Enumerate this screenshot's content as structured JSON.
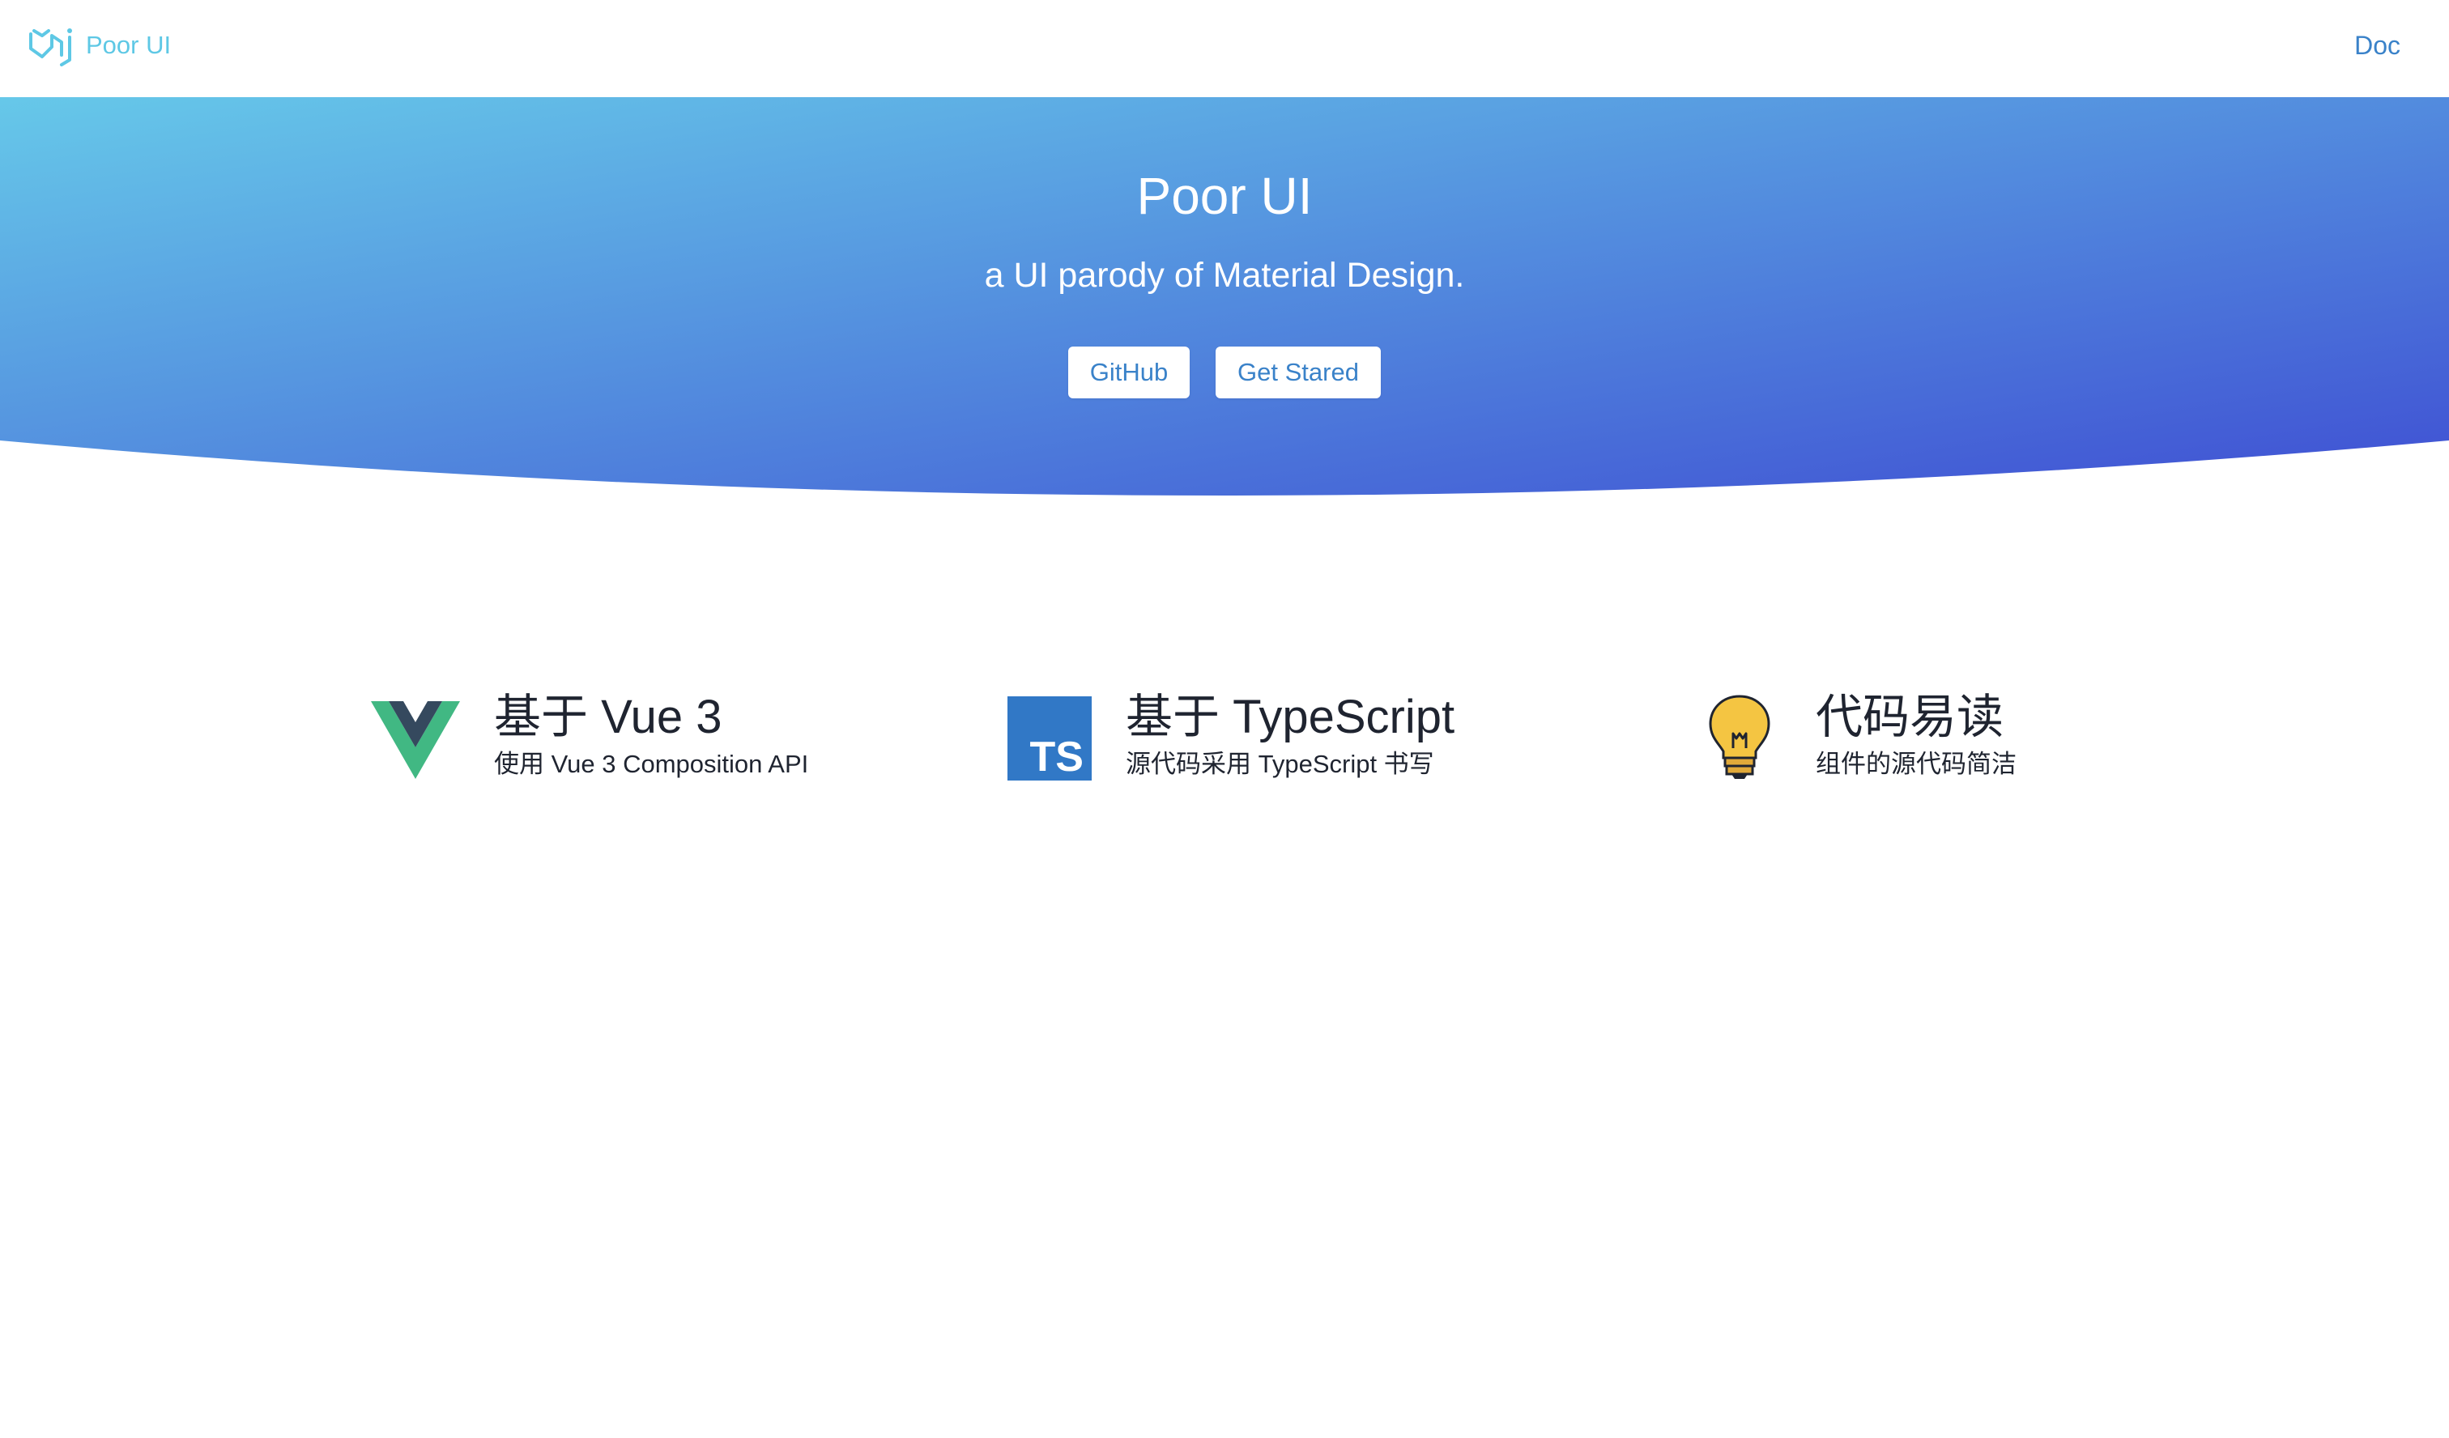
{
  "nav": {
    "logo_text": "Poor UI",
    "doc_label": "Doc"
  },
  "hero": {
    "title": "Poor UI",
    "subtitle": "a UI parody of Material Design.",
    "github_label": "GitHub",
    "start_label": "Get Stared",
    "gradient_start": "#66c8e9",
    "gradient_end": "#3f4fd3"
  },
  "features": [
    {
      "icon": "vue-logo-icon",
      "title": "基于 Vue 3",
      "description": "使用 Vue 3 Composition API"
    },
    {
      "icon": "typescript-logo-icon",
      "title": "基于 TypeScript",
      "description": "源代码采用 TypeScript 书写"
    },
    {
      "icon": "lightbulb-icon",
      "title": "代码易读",
      "description": "组件的源代码简洁"
    }
  ],
  "colors": {
    "link": "#3a82c9",
    "logo": "#5ec8e5",
    "text": "#1f2430",
    "vue_green": "#41b883",
    "vue_dark": "#35495e",
    "ts_blue": "#3178c6",
    "bulb_yellow": "#f4c542"
  }
}
